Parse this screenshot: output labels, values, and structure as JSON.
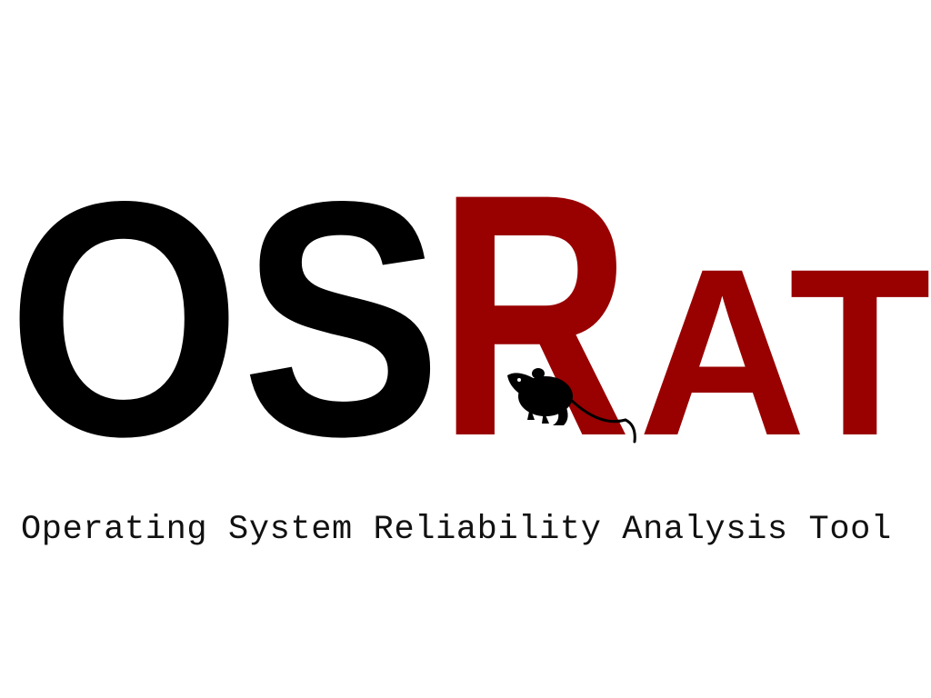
{
  "logo": {
    "text_os": "OS",
    "text_r": "R",
    "text_at": "AT",
    "os_color": "#000000",
    "rat_color": "#990000",
    "mascot_icon": "rat-silhouette-icon",
    "mascot_color": "#000000"
  },
  "subtitle": "Operating System Reliability Analysis Tool",
  "background_color": "#ffffff"
}
